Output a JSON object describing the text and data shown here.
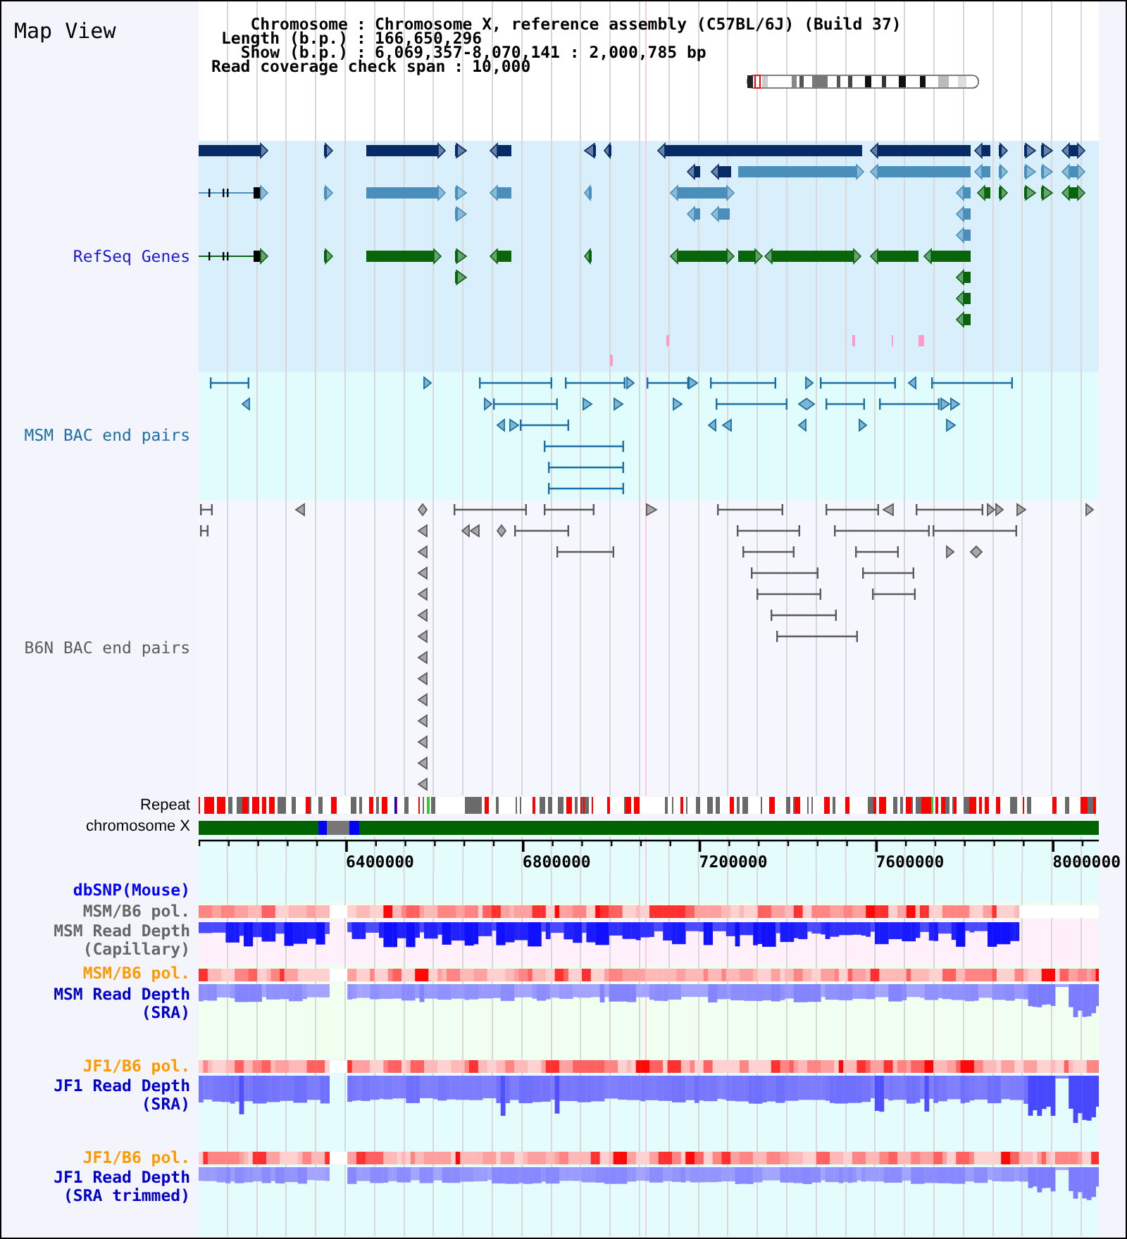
{
  "title": "Map View",
  "info": [
    {
      "label": "Chromosome",
      "separator": ":",
      "value": "Chromosome X, reference assembly (C57BL/6J) (Build 37)"
    },
    {
      "label": "Length (b.p.)",
      "separator": ":",
      "value": "166,650,296"
    },
    {
      "label": "Show (b.p.)",
      "separator": ":",
      "value": "6,069,357-8,070,141 : 2,000,785 bp"
    }
  ],
  "coverage_span": {
    "label": "Read coverage check span",
    "separator": ":",
    "value": "10,000"
  },
  "feature_tracks": [
    {
      "kind": "genes",
      "label": "RefSeq Genes",
      "color": "#1a1ad0"
    },
    {
      "kind": "pairs",
      "label": "MSM BAC end pairs",
      "color": "#1c6ea4"
    },
    {
      "kind": "pairs",
      "label": "B6N BAC end pairs",
      "color": "#5a5a5a"
    }
  ],
  "annotation_tracks": [
    {
      "kind": "repeat",
      "label": "Repeat"
    },
    {
      "kind": "chromosome",
      "label": "chromosome X"
    }
  ],
  "axis": {
    "ticks": [
      "6400000",
      "6800000",
      "7200000",
      "7600000",
      "8000000"
    ]
  },
  "data_tracks": [
    {
      "kind": "snp",
      "label": "dbSNP(Mouse)",
      "color": "#0000ff"
    },
    {
      "kind": "polymorphism",
      "label": "MSM/B6 pol.",
      "color": "#666666"
    },
    {
      "kind": "depth",
      "label": "MSM Read Depth",
      "sublabel": "(Capillary)",
      "color": "#666666"
    },
    {
      "kind": "polymorphism",
      "label": "MSM/B6 pol.",
      "color": "#ff9900"
    },
    {
      "kind": "depth",
      "label": "MSM Read Depth",
      "sublabel": "(SRA)",
      "color": "#0000cc"
    },
    {
      "kind": "polymorphism",
      "label": "JF1/B6 pol.",
      "color": "#ff9900"
    },
    {
      "kind": "depth",
      "label": "JF1 Read Depth",
      "sublabel": "(SRA)",
      "color": "#0000cc"
    },
    {
      "kind": "polymorphism",
      "label": "JF1/B6 pol.",
      "color": "#ff9900"
    },
    {
      "kind": "depth",
      "label": "JF1 Read Depth",
      "sublabel": "(SRA trimmed)",
      "color": "#0000cc"
    }
  ]
}
